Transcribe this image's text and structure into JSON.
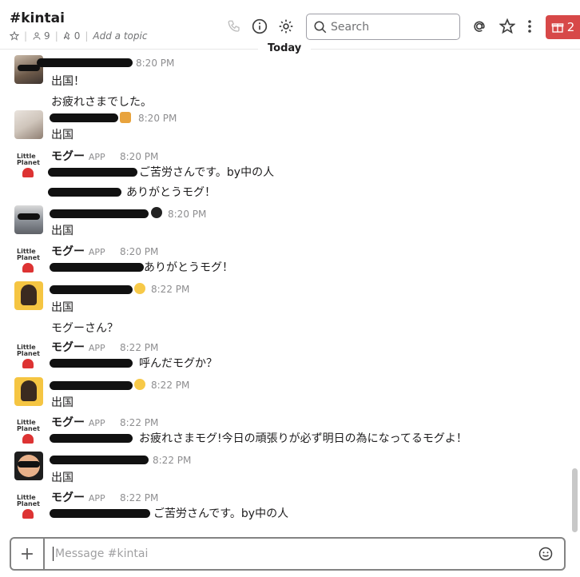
{
  "header": {
    "channel_name": "#kintai",
    "members_count": "9",
    "pins_count": "0",
    "add_topic": "Add a topic",
    "search_placeholder": "Search",
    "gift_count": "2"
  },
  "divider": {
    "label": "Today"
  },
  "messages": [
    {
      "name_redacted": true,
      "time": "8:20 PM",
      "lines": [
        "出国！",
        "お疲れさまでした。"
      ]
    },
    {
      "name_redacted": true,
      "time": "8:20 PM",
      "lines": [
        "出国"
      ]
    },
    {
      "name": "モグー",
      "tag": "APP",
      "time": "8:20 PM",
      "lines": [
        "ご苦労さんです。by中の人",
        "ありがとうモグ！"
      ]
    },
    {
      "name_redacted": true,
      "time": "8:20 PM",
      "lines": [
        "出国"
      ]
    },
    {
      "name": "モグー",
      "tag": "APP",
      "time": "8:20 PM",
      "lines": [
        "ありがとうモグ！"
      ]
    },
    {
      "name_redacted": true,
      "time": "8:22 PM",
      "lines": [
        "出国",
        "モグーさん？"
      ]
    },
    {
      "name": "モグー",
      "tag": "APP",
      "time": "8:22 PM",
      "lines": [
        "呼んだモグか？"
      ]
    },
    {
      "name_redacted": true,
      "time": "8:22 PM",
      "lines": [
        "出国"
      ]
    },
    {
      "name": "モグー",
      "tag": "APP",
      "time": "8:22 PM",
      "lines": [
        "お疲れさまモグ!今日の頑張りが必ず明日の為になってるモグよ！"
      ]
    },
    {
      "name_redacted": true,
      "time": "8:22 PM",
      "lines": [
        "出国"
      ]
    },
    {
      "name": "モグー",
      "tag": "APP",
      "time": "8:22 PM",
      "lines": [
        "ご苦労さんです。by中の人"
      ]
    }
  ],
  "composer": {
    "placeholder": "Message #kintai"
  },
  "icons": {
    "star": "star-icon",
    "members": "person-icon",
    "pin": "pin-icon",
    "call": "phone-icon",
    "info": "info-icon",
    "settings": "gear-icon",
    "search": "search-icon",
    "mentions": "at-icon",
    "starred": "star-outline-icon",
    "more": "more-vertical-icon",
    "gift": "gift-icon",
    "plus": "plus-icon",
    "emoji": "emoji-icon"
  },
  "colors": {
    "gift_bg": "#d74848",
    "text": "#1d1c1d",
    "muted": "#8e8e90"
  }
}
